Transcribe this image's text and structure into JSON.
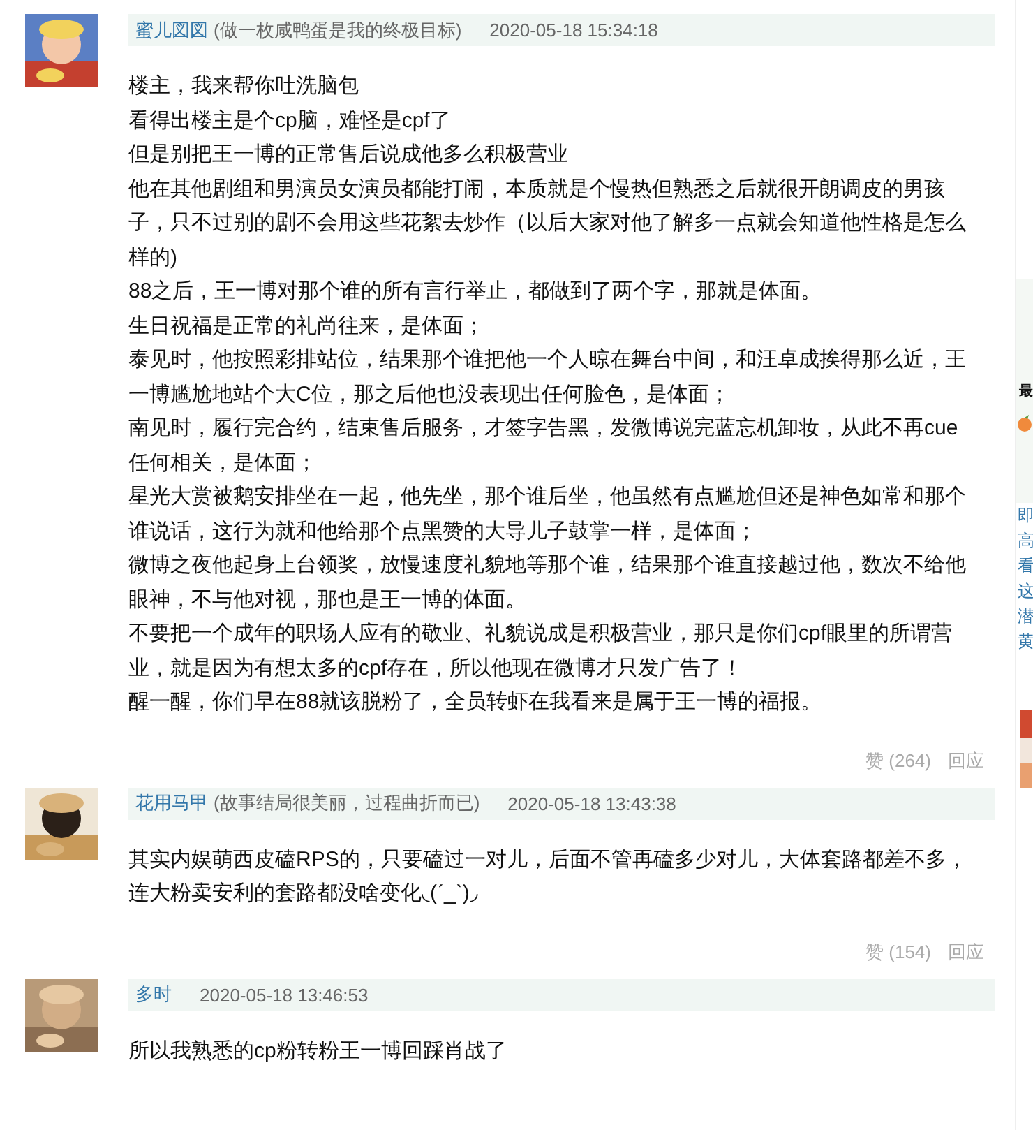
{
  "comments": [
    {
      "author": "蜜儿図図",
      "signature": "(做一枚咸鸭蛋是我的终极目标)",
      "time": "2020-05-18 15:34:18",
      "paragraphs": [
        "楼主，我来帮你吐洗脑包",
        "看得出楼主是个cp脑，难怪是cpf了",
        "但是别把王一博的正常售后说成他多么积极营业",
        "他在其他剧组和男演员女演员都能打闹，本质就是个慢热但熟悉之后就很开朗调皮的男孩子，只不过别的剧不会用这些花絮去炒作（以后大家对他了解多一点就会知道他性格是怎么样的)",
        "88之后，王一博对那个谁的所有言行举止，都做到了两个字，那就是体面。",
        "生日祝福是正常的礼尚往来，是体面；",
        "泰见时，他按照彩排站位，结果那个谁把他一个人晾在舞台中间，和汪卓成挨得那么近，王一博尴尬地站个大C位，那之后他也没表现出任何脸色，是体面；",
        "南见时，履行完合约，结束售后服务，才签字告黑，发微博说完蓝忘机卸妆，从此不再cue任何相关，是体面；",
        "星光大赏被鹅安排坐在一起，他先坐，那个谁后坐，他虽然有点尴尬但还是神色如常和那个谁说话，这行为就和他给那个点黑赞的大导儿子鼓掌一样，是体面；",
        "微博之夜他起身上台领奖，放慢速度礼貌地等那个谁，结果那个谁直接越过他，数次不给他眼神，不与他对视，那也是王一博的体面。",
        "不要把一个成年的职场人应有的敬业、礼貌说成是积极营业，那只是你们cpf眼里的所谓营业，就是因为有想太多的cpf存在，所以他现在微博才只发广告了！",
        "醒一醒，你们早在88就该脱粉了，全员转虾在我看来是属于王一博的福报。"
      ],
      "likes": "赞 (264)",
      "reply": "回应"
    },
    {
      "author": "花用马甲",
      "signature": "(故事结局很美丽，过程曲折而已)",
      "time": "2020-05-18 13:43:38",
      "paragraphs": [
        "其实内娱萌西皮磕RPS的，只要磕过一对儿，后面不管再磕多少对儿，大体套路都差不多，连大粉卖安利的套路都没啥变化◟(ˊ_ˋ)◞"
      ],
      "likes": "赞 (154)",
      "reply": "回应"
    },
    {
      "author": "多时",
      "time": "2020-05-18 13:46:53",
      "paragraphs": [
        "所以我熟悉的cp粉转粉王一博回踩肖战了"
      ]
    }
  ],
  "sidebar": {
    "heading": "最",
    "items": [
      "即",
      "高",
      "看",
      "这",
      "潜",
      "黄"
    ]
  }
}
